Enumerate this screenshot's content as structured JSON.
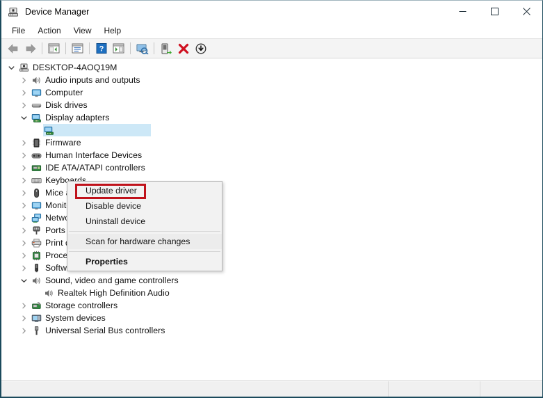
{
  "window": {
    "title": "Device Manager",
    "icon": "device-manager-icon",
    "controls": {
      "minimize": "minimize-icon",
      "maximize": "maximize-icon",
      "close": "close-icon"
    }
  },
  "menubar": {
    "items": [
      {
        "label": "File"
      },
      {
        "label": "Action"
      },
      {
        "label": "View"
      },
      {
        "label": "Help"
      }
    ]
  },
  "toolbar": {
    "buttons": [
      {
        "name": "back-icon",
        "tip": "Back"
      },
      {
        "name": "forward-icon",
        "tip": "Forward"
      },
      {
        "sep": true
      },
      {
        "name": "show-hide-console-tree-icon",
        "tip": "Show/Hide Console Tree"
      },
      {
        "sep": true
      },
      {
        "name": "properties-icon",
        "tip": "Properties"
      },
      {
        "sep": true
      },
      {
        "name": "help-icon",
        "tip": "Help"
      },
      {
        "name": "show-hide-action-pane-icon",
        "tip": "Show/Hide Action Pane"
      },
      {
        "sep": true
      },
      {
        "name": "scan-for-hardware-changes-icon",
        "tip": "Scan for hardware changes"
      },
      {
        "sep": true
      },
      {
        "name": "update-driver-icon",
        "tip": "Update driver"
      },
      {
        "name": "uninstall-device-icon",
        "tip": "Uninstall device"
      },
      {
        "name": "disable-device-icon",
        "tip": "Disable device"
      }
    ]
  },
  "tree": {
    "root": {
      "label": "DESKTOP-4AOQ19M",
      "icon": "computer-root-icon",
      "expanded": true
    },
    "items": [
      {
        "label": "Audio inputs and outputs",
        "icon": "speaker-icon",
        "indent": 1,
        "expandable": true,
        "expanded": false
      },
      {
        "label": "Computer",
        "icon": "monitor-icon",
        "indent": 1,
        "expandable": true,
        "expanded": false
      },
      {
        "label": "Disk drives",
        "icon": "disk-icon",
        "indent": 1,
        "expandable": true,
        "expanded": false
      },
      {
        "label": "Display adapters",
        "icon": "display-adapter-icon",
        "indent": 1,
        "expandable": true,
        "expanded": true
      },
      {
        "label": "",
        "icon": "display-adapter-icon",
        "indent": 2,
        "expandable": false,
        "expanded": false,
        "selected": true
      },
      {
        "label": "Firmware",
        "icon": "firmware-icon",
        "indent": 1,
        "expandable": true,
        "expanded": false
      },
      {
        "label": "Human Interface Devices",
        "icon": "hid-icon",
        "indent": 1,
        "expandable": true,
        "expanded": false
      },
      {
        "label": "IDE ATA/ATAPI controllers",
        "icon": "ide-controller-icon",
        "indent": 1,
        "expandable": true,
        "expanded": false
      },
      {
        "label": "Keyboards",
        "icon": "keyboard-icon",
        "indent": 1,
        "expandable": true,
        "expanded": false
      },
      {
        "label": "Mice and other pointing devices",
        "icon": "mouse-icon",
        "indent": 1,
        "expandable": true,
        "expanded": false
      },
      {
        "label": "Monitors",
        "icon": "monitor-icon",
        "indent": 1,
        "expandable": true,
        "expanded": false
      },
      {
        "label": "Network adapters",
        "icon": "network-adapter-icon",
        "indent": 1,
        "expandable": true,
        "expanded": false
      },
      {
        "label": "Ports (COM & LPT)",
        "icon": "port-icon",
        "indent": 1,
        "expandable": true,
        "expanded": false
      },
      {
        "label": "Print queues",
        "icon": "printer-icon",
        "indent": 1,
        "expandable": true,
        "expanded": false
      },
      {
        "label": "Processors",
        "icon": "processor-icon",
        "indent": 1,
        "expandable": true,
        "expanded": false
      },
      {
        "label": "Software devices",
        "icon": "software-device-icon",
        "indent": 1,
        "expandable": true,
        "expanded": false
      },
      {
        "label": "Sound, video and game controllers",
        "icon": "speaker-icon",
        "indent": 1,
        "expandable": true,
        "expanded": true
      },
      {
        "label": "Realtek High Definition Audio",
        "icon": "speaker-icon",
        "indent": 2,
        "expandable": false,
        "expanded": false
      },
      {
        "label": "Storage controllers",
        "icon": "storage-controller-icon",
        "indent": 1,
        "expandable": true,
        "expanded": false
      },
      {
        "label": "System devices",
        "icon": "system-device-icon",
        "indent": 1,
        "expandable": true,
        "expanded": false
      },
      {
        "label": "Universal Serial Bus controllers",
        "icon": "usb-icon",
        "indent": 1,
        "expandable": true,
        "expanded": false
      }
    ]
  },
  "context_menu": {
    "items": [
      {
        "label": "Update driver",
        "bold": false,
        "highlighted": true
      },
      {
        "label": "Disable device",
        "bold": false,
        "highlighted": false
      },
      {
        "label": "Uninstall device",
        "bold": false,
        "highlighted": false
      },
      {
        "sep": true
      },
      {
        "label": "Scan for hardware changes",
        "bold": false,
        "highlighted": false,
        "hover": true
      },
      {
        "sep": true
      },
      {
        "label": "Properties",
        "bold": true,
        "highlighted": false
      }
    ]
  },
  "annotation": {
    "highlight_color": "#c0121b",
    "target": "Update driver"
  },
  "statusbar": {
    "panes": [
      "",
      "",
      ""
    ]
  }
}
